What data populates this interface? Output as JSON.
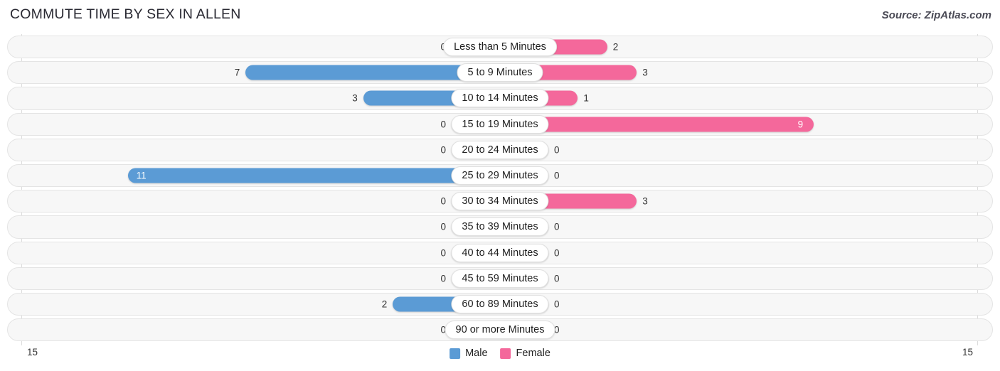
{
  "header": {
    "title": "COMMUTE TIME BY SEX IN ALLEN",
    "source": "Source: ZipAtlas.com"
  },
  "legend": {
    "male_label": "Male",
    "female_label": "Female",
    "male_color": "#5B9BD5",
    "female_color": "#F4689B"
  },
  "axis": {
    "left_label": "15",
    "right_label": "15"
  },
  "colors": {
    "male_strong": "#5B9BD5",
    "male_light": "#A8C8EC",
    "female_strong": "#F4689B",
    "female_light": "#F79EBE",
    "track_fill": "#F7F7F7",
    "track_border": "#E4E4E4"
  },
  "chart_data": {
    "type": "bar",
    "orientation": "horizontal-diverging",
    "title": "COMMUTE TIME BY SEX IN ALLEN",
    "xlabel": "",
    "ylabel": "",
    "xlim": [
      15,
      15
    ],
    "grid": true,
    "legend_position": "bottom-center",
    "categories": [
      "Less than 5 Minutes",
      "5 to 9 Minutes",
      "10 to 14 Minutes",
      "15 to 19 Minutes",
      "20 to 24 Minutes",
      "25 to 29 Minutes",
      "30 to 34 Minutes",
      "35 to 39 Minutes",
      "40 to 44 Minutes",
      "45 to 59 Minutes",
      "60 to 89 Minutes",
      "90 or more Minutes"
    ],
    "series": [
      {
        "name": "Male",
        "values": [
          0,
          7,
          3,
          0,
          0,
          11,
          0,
          0,
          0,
          0,
          2,
          0
        ]
      },
      {
        "name": "Female",
        "values": [
          2,
          3,
          1,
          9,
          0,
          0,
          3,
          0,
          0,
          0,
          0,
          0
        ]
      }
    ]
  }
}
